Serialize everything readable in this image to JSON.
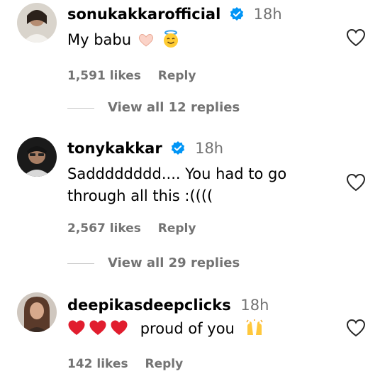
{
  "comments": [
    {
      "username": "sonukakkarofficial",
      "verified": true,
      "time": "18h",
      "text": "My babu",
      "emojis": [
        "heart-hands-emoji",
        "smiling-face-with-halo-emoji"
      ],
      "likes": "1,591 likes",
      "reply_label": "Reply",
      "view_replies": "View all 12 replies"
    },
    {
      "username": "tonykakkar",
      "verified": true,
      "time": "18h",
      "text_line1": "Sadddddddd.... You had to go",
      "text_line2": "through all this :((((",
      "likes": "2,567 likes",
      "reply_label": "Reply",
      "view_replies": "View all 29 replies"
    },
    {
      "username": "deepikasdeepclicks",
      "verified": false,
      "time": "18h",
      "text": "proud of you",
      "emojis": [
        "red-heart-emoji",
        "red-heart-emoji",
        "red-heart-emoji",
        "raising-hands-emoji"
      ],
      "likes": "142 likes",
      "reply_label": "Reply"
    }
  ],
  "colors": {
    "secondary_text": "#737373",
    "verified_badge": "#0095f6",
    "heart_red": "#e0245e"
  }
}
